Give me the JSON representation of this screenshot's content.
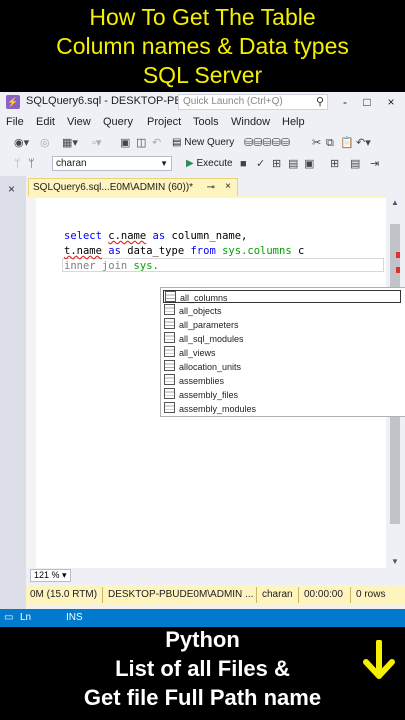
{
  "overlay_top": [
    "How To Get The Table",
    "Column names & Data types",
    "SQL Server"
  ],
  "window": {
    "title": "SQLQuery6.sql - DESKTOP-PB...",
    "quick_launch_placeholder": "Quick Launch (Ctrl+Q)",
    "controls": [
      "-",
      "□",
      "×"
    ]
  },
  "menu": [
    "File",
    "Edit",
    "View",
    "Query",
    "Project",
    "Tools",
    "Window",
    "Help"
  ],
  "toolbar": {
    "new_query": "New Query",
    "database": "charan",
    "execute": "Execute"
  },
  "tab": {
    "label": "SQLQuery6.sql...E0M\\ADMIN (60))*",
    "pin": "⊸",
    "close": "×"
  },
  "code": {
    "line1": {
      "kw1": "select",
      "obj": "c.name",
      "kw2": "as",
      "rest": "column_name,"
    },
    "line2": {
      "obj": "t.name",
      "kw1": "as",
      "mid": "data_type",
      "kw2": "from",
      "sys": "sys.columns",
      "alias": "c"
    },
    "line3": {
      "text": "inner join",
      "sys": "sys."
    }
  },
  "intellisense": [
    "all_columns",
    "all_objects",
    "all_parameters",
    "all_sql_modules",
    "all_views",
    "allocation_units",
    "assemblies",
    "assembly_files",
    "assembly_modules"
  ],
  "zoom": "121 %",
  "status": {
    "server_version": "0M (15.0 RTM)",
    "server": "DESKTOP-PBUDE0M\\ADMIN ...",
    "user": "charan",
    "time": "00:00:00",
    "rows": "0 rows"
  },
  "bottom_status": {
    "ln": "Ln",
    "ins": "INS"
  },
  "overlay_bottom": [
    "Python",
    "List of all Files &",
    "Get file Full Path name"
  ],
  "colors": {
    "accent_yellow": "#f5f000",
    "tab_yellow": "#fdf4bf",
    "status_blue": "#007acc"
  }
}
